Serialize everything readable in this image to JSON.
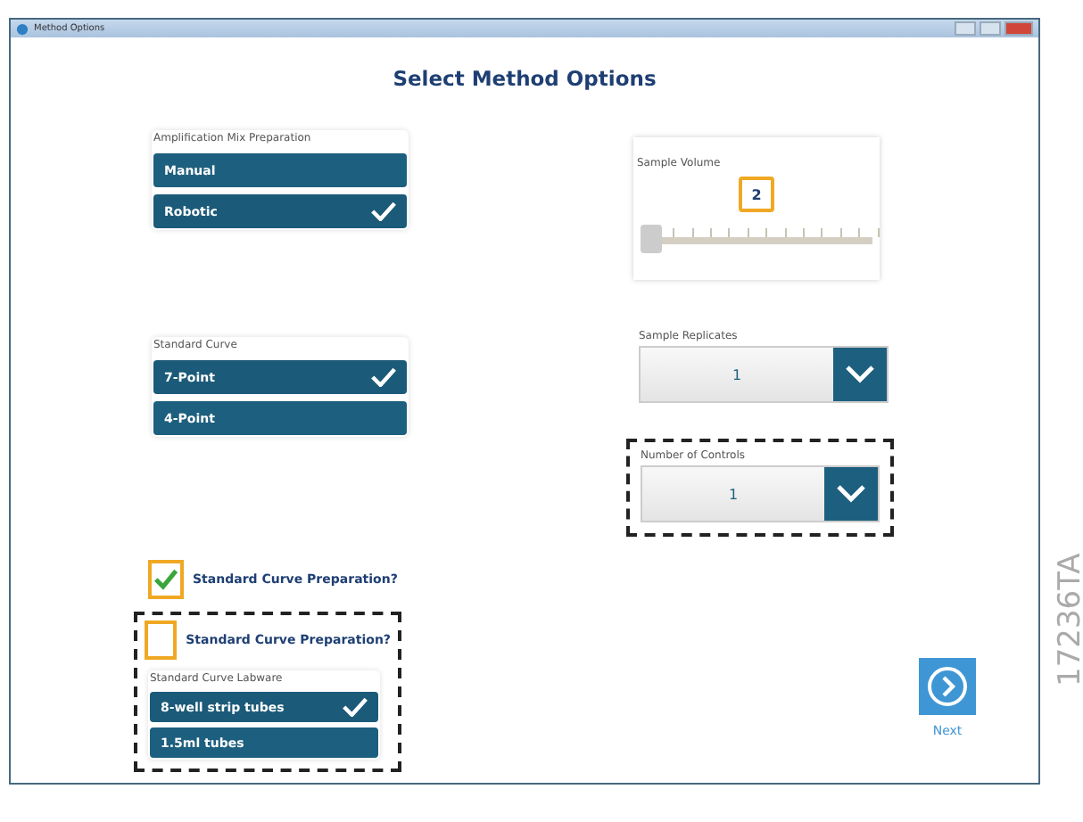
{
  "window": {
    "title": "Method Options"
  },
  "heading": "Select Method Options",
  "amplification_mix": {
    "label": "Amplification Mix Preparation",
    "options": [
      {
        "label": "Manual",
        "selected": false
      },
      {
        "label": "Robotic",
        "selected": true
      }
    ]
  },
  "standard_curve": {
    "label": "Standard Curve",
    "options": [
      {
        "label": "7-Point",
        "selected": true
      },
      {
        "label": "4-Point",
        "selected": false
      }
    ]
  },
  "preparation_examples": [
    {
      "label": "Standard Curve Preparation?",
      "checked": true,
      "highlighted": false
    },
    {
      "label": "Standard Curve Preparation?",
      "checked": false,
      "highlighted": true,
      "labware": {
        "label": "Standard Curve Labware",
        "options": [
          {
            "label": "8-well strip tubes",
            "selected": true
          },
          {
            "label": "1.5ml tubes",
            "selected": false
          }
        ]
      }
    }
  ],
  "sample_volume": {
    "label": "Sample Volume",
    "value": "2",
    "level": 0
  },
  "sample_replicates": {
    "label": "Sample Replicates",
    "value": "1",
    "highlighted": false
  },
  "number_of_controls": {
    "label": "Number of Controls",
    "value": "1",
    "highlighted": true
  },
  "next_button": {
    "label": "Next"
  },
  "figure_id": "17236TA"
}
